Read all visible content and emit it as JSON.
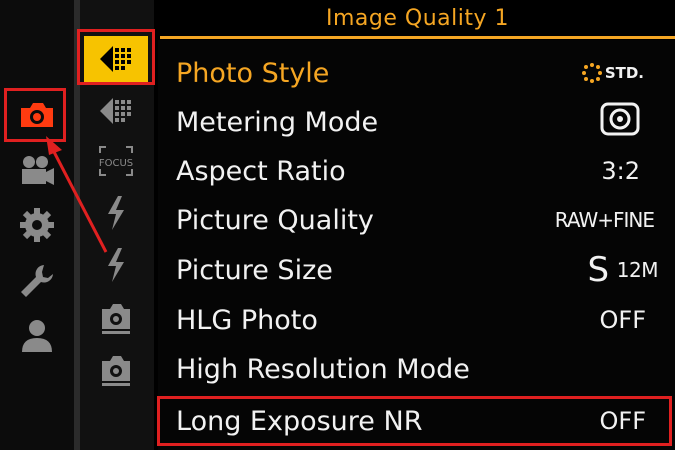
{
  "header": {
    "title": "Image Quality 1"
  },
  "categories": [
    {
      "name": "photo",
      "icon": "camera-icon",
      "selected": true
    },
    {
      "name": "video",
      "icon": "video-camera-icon"
    },
    {
      "name": "custom",
      "icon": "gear-icon"
    },
    {
      "name": "setup",
      "icon": "wrench-icon"
    },
    {
      "name": "my-menu",
      "icon": "person-icon"
    }
  ],
  "sub_tabs": [
    {
      "name": "image-quality-1",
      "icon": "image-quality-icon",
      "selected": true
    },
    {
      "name": "image-quality-2",
      "icon": "image-quality-icon"
    },
    {
      "name": "focus",
      "icon": "focus-icon",
      "label": "FOCUS"
    },
    {
      "name": "flash-1",
      "icon": "flash-icon"
    },
    {
      "name": "flash-2",
      "icon": "flash-icon"
    },
    {
      "name": "other-1",
      "icon": "camera-small-icon"
    },
    {
      "name": "other-2",
      "icon": "camera-small-icon"
    }
  ],
  "menu": {
    "items": [
      {
        "label": "Photo Style",
        "value": "STD."
      },
      {
        "label": "Metering Mode",
        "value": ""
      },
      {
        "label": "Aspect Ratio",
        "value": "3:2"
      },
      {
        "label": "Picture Quality",
        "value": "RAW+FINE"
      },
      {
        "label": "Picture Size",
        "value_big": "S",
        "value_small": "12M"
      },
      {
        "label": "HLG Photo",
        "value": "OFF"
      },
      {
        "label": "High Resolution Mode",
        "value": ""
      },
      {
        "label": "Long Exposure NR",
        "value": "OFF"
      }
    ]
  },
  "colors": {
    "accent": "#f5a623",
    "highlight_red": "#e02020",
    "selected_tab": "#f7c300",
    "camera_orange": "#ff3b10"
  }
}
